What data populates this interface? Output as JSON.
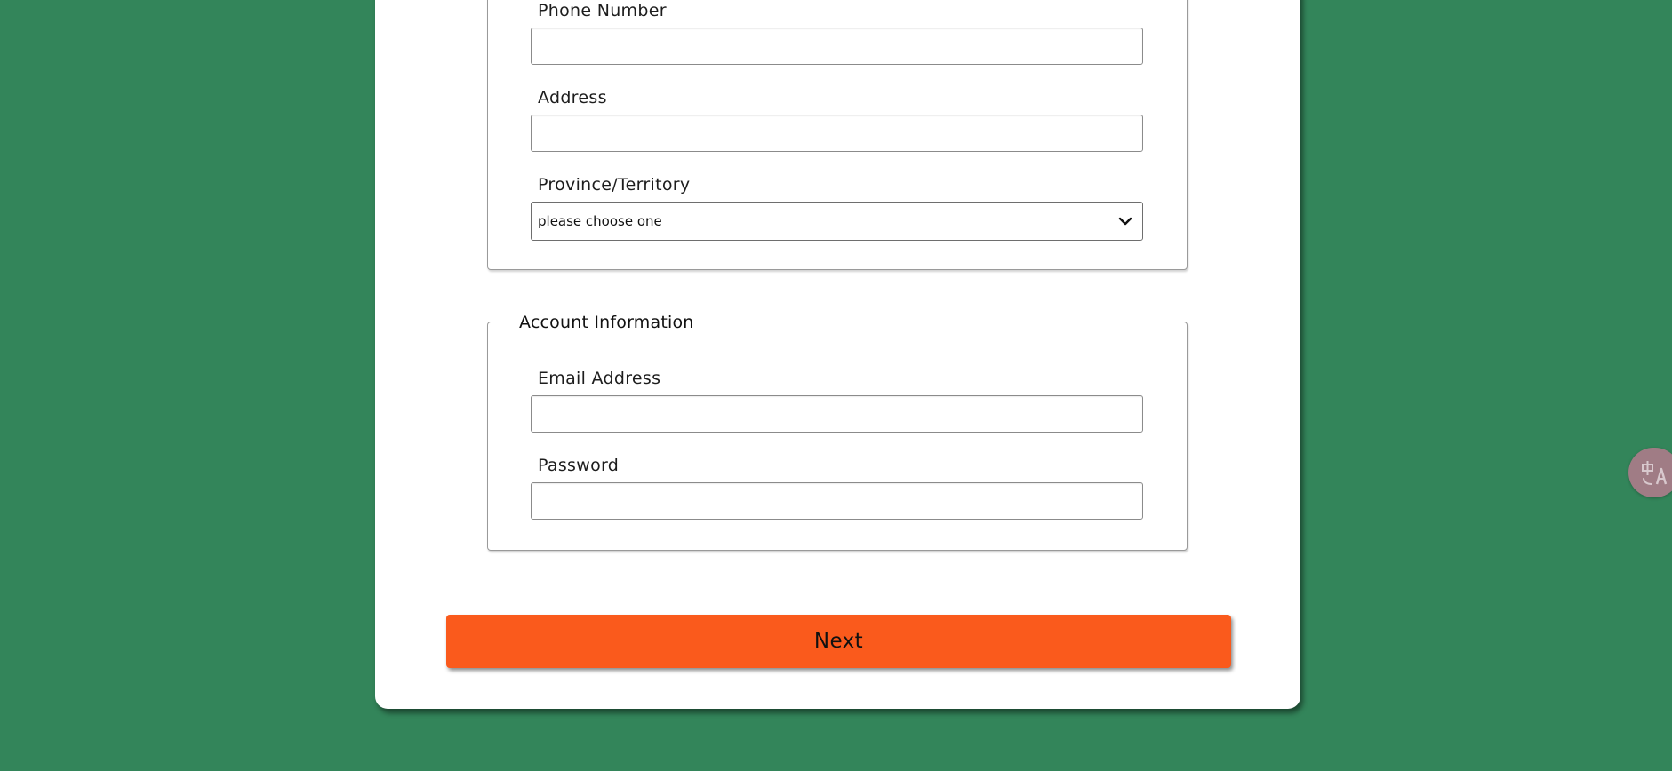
{
  "form": {
    "contact_section": {
      "fields": [
        {
          "label": "Phone Number",
          "value": "",
          "placeholder": ""
        },
        {
          "label": "Address",
          "value": "",
          "placeholder": ""
        }
      ],
      "province": {
        "label": "Province/Territory",
        "selected": "please choose one"
      }
    },
    "account_section": {
      "legend": "Account Information",
      "fields": [
        {
          "label": "Email Address",
          "value": "",
          "placeholder": ""
        },
        {
          "label": "Password",
          "value": "",
          "placeholder": ""
        }
      ]
    },
    "next_label": "Next"
  },
  "icons": {
    "select_arrow": "chevron-down-icon",
    "translate_widget": "translate-icon"
  },
  "colors": {
    "background": "#33855a",
    "card": "#ffffff",
    "primary_button": "#fa5a1c",
    "translate_widget": "#a07c85"
  }
}
